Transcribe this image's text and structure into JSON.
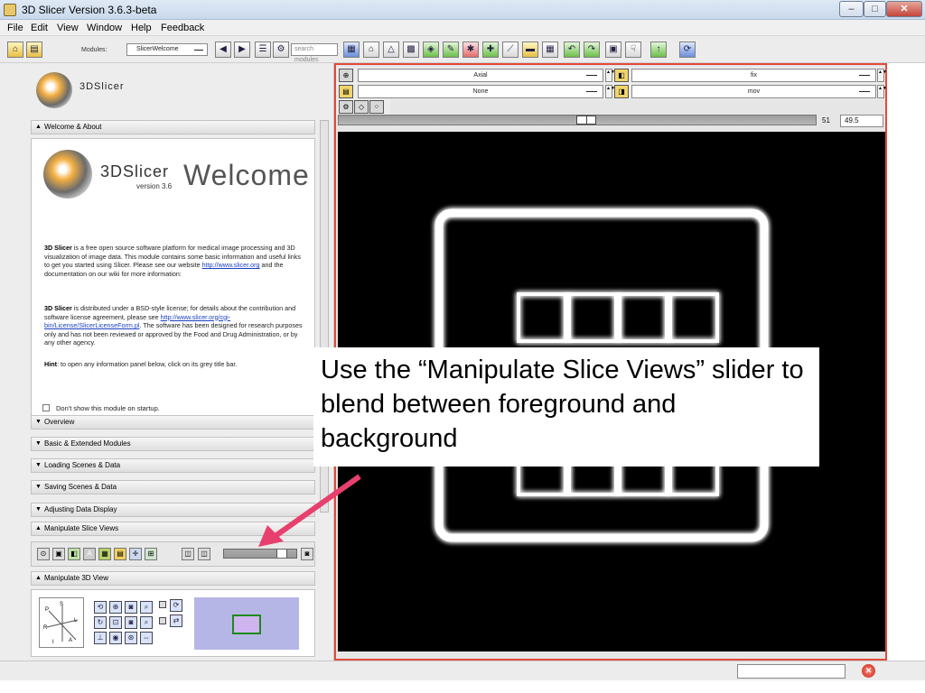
{
  "window": {
    "title": "3D Slicer Version 3.6.3-beta",
    "minimize": "–",
    "maximize": "□",
    "close": "✕"
  },
  "menu": [
    "File",
    "Edit",
    "View",
    "Window",
    "Help",
    "Feedback"
  ],
  "toolbar": {
    "modules_label": "Modules:",
    "module_value": "SlicerWelcome",
    "search_placeholder": "search modules"
  },
  "brand": {
    "name": "3DSlicer"
  },
  "welcome": {
    "header": "Welcome & About",
    "brand": "3DSlicer",
    "version": "version 3.6",
    "title": "Welcome",
    "p1_lead": "3D Slicer",
    "p1_a": " is a free open source software platform for medical image processing and 3D visualization of image data. This module contains some basic information and useful links to get you started using Slicer. Please see our website ",
    "p1_link": "http://www.slicer.org",
    "p1_b": " and the documentation on our wiki for more information:",
    "p2_lead": "3D Slicer",
    "p2_a": " is distributed under a BSD-style license; for details about the contribution and software license agreement, please see ",
    "p2_link": "http://www.slicer.org/cgi-bin/License/SlicerLicenseForm.pl",
    "p2_b": ". The software has been designed for research purposes only and has not been reviewed or approved by the Food and Drug Administration, or by any other agency.",
    "hint_lead": "Hint",
    "hint": ": to open any information panel below, click on its grey title bar.",
    "dont_show": "Don't show this module on startup."
  },
  "panels": [
    "Overview",
    "Basic & Extended Modules",
    "Loading Scenes & Data",
    "Saving Scenes & Data",
    "Adjusting Data Display",
    "Manipulate Slice Views",
    "Manipulate 3D View"
  ],
  "fade_slider": {
    "value": 0.85
  },
  "compass": {
    "p": "P",
    "s": "S",
    "l": "L",
    "r": "R",
    "i": "I",
    "a": "A"
  },
  "viewer": {
    "orientation": "Axial",
    "label_layer": "None",
    "foreground": "fix",
    "background": "mov",
    "slice_index": "51",
    "slice_offset": "49.5"
  },
  "callout": "Use the “Manipulate Slice Views” slider to blend between foreground and background",
  "colors": {
    "accent_border": "#e24a3a",
    "arrow": "#e8406e"
  }
}
